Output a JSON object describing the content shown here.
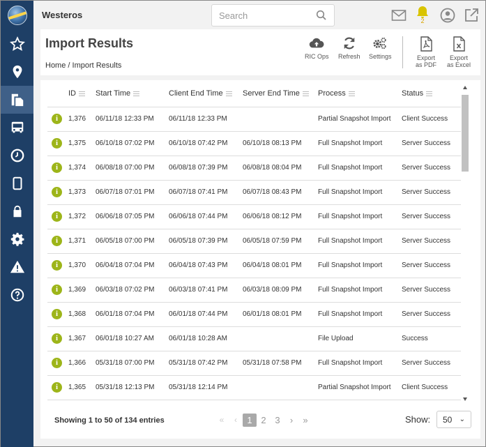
{
  "app": {
    "title": "Westeros"
  },
  "search": {
    "placeholder": "Search"
  },
  "notifications": {
    "count": "2"
  },
  "page": {
    "title": "Import Results",
    "breadcrumb": "Home / Import Results"
  },
  "toolbar": {
    "ric_ops": "RIC Ops",
    "refresh": "Refresh",
    "settings": "Settings",
    "export_pdf_l1": "Export",
    "export_pdf_l2": "as PDF",
    "export_excel_l1": "Export",
    "export_excel_l2": "as Excel"
  },
  "sidebar": {
    "items": [
      {
        "icon": "star-icon"
      },
      {
        "icon": "map-pin-icon"
      },
      {
        "icon": "documents-icon",
        "active": true
      },
      {
        "icon": "bus-icon"
      },
      {
        "icon": "clock-icon"
      },
      {
        "icon": "tablet-icon"
      },
      {
        "icon": "lock-icon"
      },
      {
        "icon": "gear-icon"
      },
      {
        "icon": "warning-icon"
      },
      {
        "icon": "help-icon"
      }
    ]
  },
  "table": {
    "columns": [
      "ID",
      "Start Time",
      "Client End Time",
      "Server End Time",
      "Process",
      "Status"
    ],
    "rows": [
      {
        "id": "1,376",
        "start": "06/11/18 12:33 PM",
        "client_end": "06/11/18 12:33 PM",
        "server_end": "",
        "process": "Partial Snapshot Import",
        "status": "Client Success"
      },
      {
        "id": "1,375",
        "start": "06/10/18 07:02 PM",
        "client_end": "06/10/18 07:42 PM",
        "server_end": "06/10/18 08:13 PM",
        "process": "Full Snapshot Import",
        "status": "Server Success"
      },
      {
        "id": "1,374",
        "start": "06/08/18 07:00 PM",
        "client_end": "06/08/18 07:39 PM",
        "server_end": "06/08/18 08:04 PM",
        "process": "Full Snapshot Import",
        "status": "Server Success"
      },
      {
        "id": "1,373",
        "start": "06/07/18 07:01 PM",
        "client_end": "06/07/18 07:41 PM",
        "server_end": "06/07/18 08:43 PM",
        "process": "Full Snapshot Import",
        "status": "Server Success"
      },
      {
        "id": "1,372",
        "start": "06/06/18 07:05 PM",
        "client_end": "06/06/18 07:44 PM",
        "server_end": "06/06/18 08:12 PM",
        "process": "Full Snapshot Import",
        "status": "Server Success"
      },
      {
        "id": "1,371",
        "start": "06/05/18 07:00 PM",
        "client_end": "06/05/18 07:39 PM",
        "server_end": "06/05/18 07:59 PM",
        "process": "Full Snapshot Import",
        "status": "Server Success"
      },
      {
        "id": "1,370",
        "start": "06/04/18 07:04 PM",
        "client_end": "06/04/18 07:43 PM",
        "server_end": "06/04/18 08:01 PM",
        "process": "Full Snapshot Import",
        "status": "Server Success"
      },
      {
        "id": "1,369",
        "start": "06/03/18 07:02 PM",
        "client_end": "06/03/18 07:41 PM",
        "server_end": "06/03/18 08:09 PM",
        "process": "Full Snapshot Import",
        "status": "Server Success"
      },
      {
        "id": "1,368",
        "start": "06/01/18 07:04 PM",
        "client_end": "06/01/18 07:44 PM",
        "server_end": "06/01/18 08:01 PM",
        "process": "Full Snapshot Import",
        "status": "Server Success"
      },
      {
        "id": "1,367",
        "start": "06/01/18 10:27 AM",
        "client_end": "06/01/18 10:28 AM",
        "server_end": "",
        "process": "File Upload",
        "status": "Success"
      },
      {
        "id": "1,366",
        "start": "05/31/18 07:00 PM",
        "client_end": "05/31/18 07:42 PM",
        "server_end": "05/31/18 07:58 PM",
        "process": "Full Snapshot Import",
        "status": "Server Success"
      },
      {
        "id": "1,365",
        "start": "05/31/18 12:13 PM",
        "client_end": "05/31/18 12:14 PM",
        "server_end": "",
        "process": "Partial Snapshot Import",
        "status": "Client Success"
      }
    ]
  },
  "footer": {
    "info": "Showing 1 to 50 of 134 entries",
    "pages": [
      "1",
      "2",
      "3"
    ],
    "current_page": "1",
    "show_label": "Show:",
    "page_size": "50"
  },
  "colors": {
    "sidebar": "#1e3f66",
    "sidebar_active": "#3f6088",
    "info_icon": "#9db519",
    "bell": "#d9c400"
  }
}
